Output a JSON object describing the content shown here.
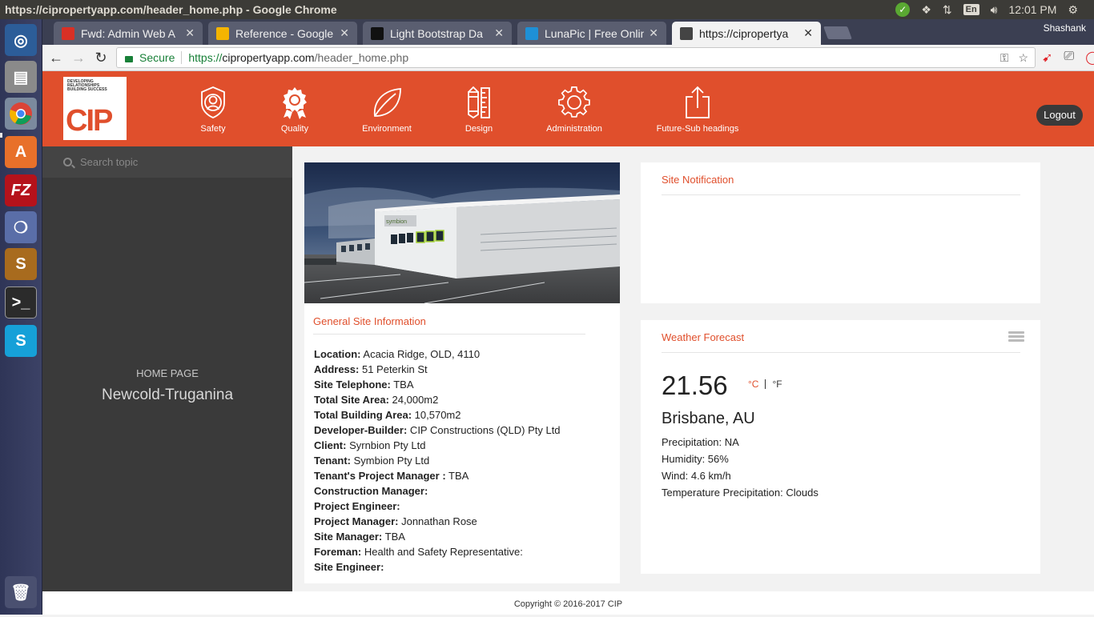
{
  "system": {
    "window_title": "https://cipropertyapp.com/header_home.php - Google Chrome",
    "time": "12:01 PM",
    "keyboard": "En"
  },
  "browser": {
    "tabs": [
      {
        "label": "Fwd: Admin Web A",
        "favicon": "gmail-icon",
        "color": "#d93025"
      },
      {
        "label": "Reference - Google",
        "favicon": "drive-icon",
        "color": "#f4b400"
      },
      {
        "label": "Light Bootstrap Da",
        "favicon": "bootstrap-icon",
        "color": "#111111"
      },
      {
        "label": "LunaPic | Free Onlin",
        "favicon": "lunapic-icon",
        "color": "#1e90d6"
      },
      {
        "label": "https://cipropertya",
        "favicon": "site-icon",
        "color": "#444444"
      }
    ],
    "profile": "Shashank",
    "secure_label": "Secure",
    "url_scheme": "https://",
    "url_host": "cipropertyapp.com",
    "url_path": "/header_home.php"
  },
  "app": {
    "logo_tagline": "DEVELOPING RELATIONSHIPS BUILDING SUCCESS",
    "logo_text": "CIP",
    "nav": [
      {
        "label": "Safety",
        "icon": "shield-icon"
      },
      {
        "label": "Quality",
        "icon": "award-icon"
      },
      {
        "label": "Environment",
        "icon": "leaf-icon"
      },
      {
        "label": "Design",
        "icon": "pencil-ruler-icon"
      },
      {
        "label": "Administration",
        "icon": "gear-icon"
      },
      {
        "label": "Future-Sub headings",
        "icon": "share-icon"
      }
    ],
    "logout": "Logout",
    "accent": "#e04f2c"
  },
  "sidebar": {
    "search_placeholder": "Search topic",
    "home_label": "HOME PAGE",
    "site_name": "Newcold-Truganina"
  },
  "general_info": {
    "title": "General Site Information",
    "rows": [
      {
        "label": "Location:",
        "value": " Acacia Ridge, OLD, 4110"
      },
      {
        "label": "Address:",
        "value": " 51 Peterkin St"
      },
      {
        "label": "Site Telephone:",
        "value": " TBA"
      },
      {
        "label": "Total Site Area:",
        "value": " 24,000m2"
      },
      {
        "label": "Total Building Area:",
        "value": " 10,570m2"
      },
      {
        "label": "Developer-Builder:",
        "value": " CIP Constructions (QLD) Pty Ltd"
      },
      {
        "label": "Client:",
        "value": " Syrnbion Pty Ltd"
      },
      {
        "label": "Tenant:",
        "value": " Symbion Pty Ltd"
      },
      {
        "label": "Tenant's Project Manager :",
        "value": " TBA"
      },
      {
        "label": "Construction Manager:",
        "value": ""
      },
      {
        "label": "Project Engineer:",
        "value": ""
      },
      {
        "label": "Project Manager:",
        "value": " Jonnathan Rose"
      },
      {
        "label": "Site Manager:",
        "value": " TBA"
      },
      {
        "label": "Foreman:",
        "value": " Health and Safety Representative:"
      },
      {
        "label": "Site Engineer:",
        "value": ""
      }
    ]
  },
  "notification": {
    "title": "Site Notification"
  },
  "weather": {
    "title": "Weather Forecast",
    "temperature": "21.56",
    "unit_c": "°C",
    "unit_f": "°F",
    "city": "Brisbane, AU",
    "precipitation": "Precipitation: NA",
    "humidity": "Humidity: 56%",
    "wind": "Wind: 4.6 km/h",
    "temp_precipitation": "Temperature Precipitation: Clouds"
  },
  "footer": {
    "copyright": "Copyright © 2016-2017 CIP"
  }
}
